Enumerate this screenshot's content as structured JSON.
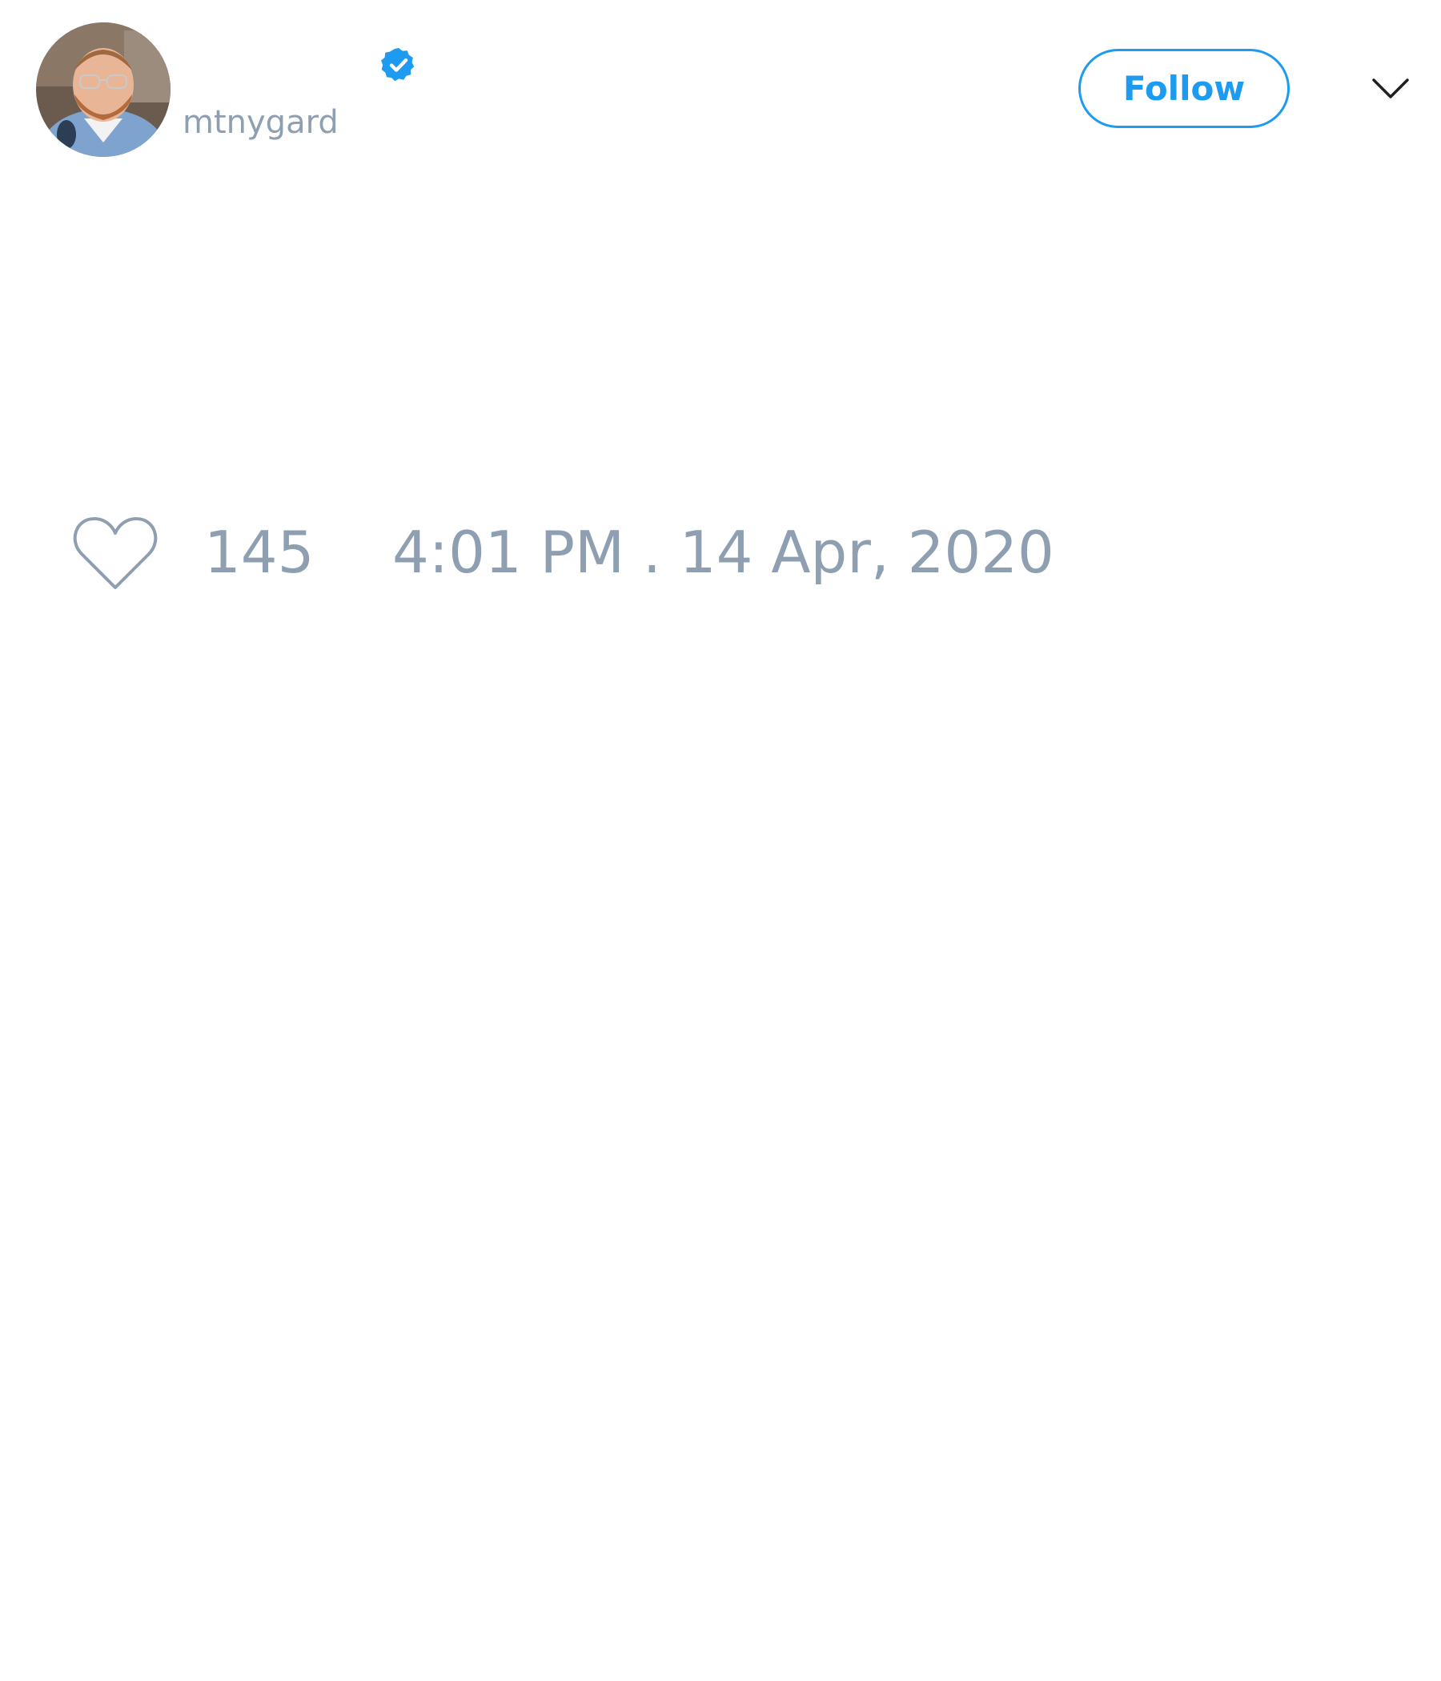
{
  "author": {
    "display_name": "",
    "handle": "mtnygard",
    "verified": true,
    "avatar_icon": "user-avatar"
  },
  "actions": {
    "follow_label": "Follow",
    "more_icon": "chevron-down-icon"
  },
  "stats": {
    "like_icon": "heart-icon",
    "like_count": "145",
    "timestamp": "4:01 PM . 14 Apr, 2020"
  },
  "colors": {
    "accent": "#1d9bf0",
    "muted_text": "#8f9fb2",
    "background": "#ffffff"
  }
}
